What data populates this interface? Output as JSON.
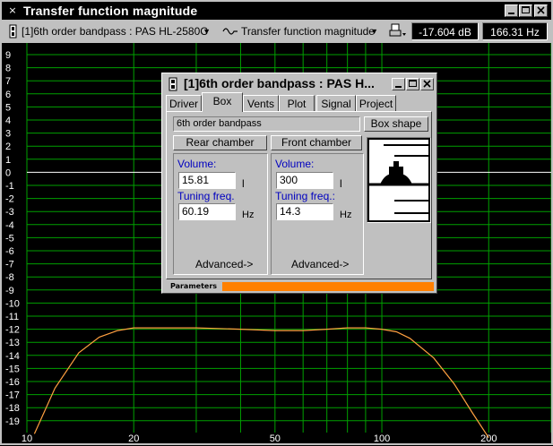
{
  "window": {
    "title": "Transfer function magnitude",
    "system_menu_glyph": "×"
  },
  "toolbar": {
    "project_select": "[1]6th order bandpass : PAS HL-2580C",
    "view_select": "Transfer function magnitude",
    "level_readout": "-17.604 dB",
    "freq_readout": "166.31 Hz"
  },
  "plot": {
    "y_ticks": [
      "9",
      "8",
      "7",
      "6",
      "5",
      "4",
      "3",
      "2",
      "1",
      "0",
      "-1",
      "-2",
      "-3",
      "-4",
      "-5",
      "-6",
      "-7",
      "-8",
      "-9",
      "-10",
      "-11",
      "-12",
      "-13",
      "-14",
      "-15",
      "-16",
      "-17",
      "-18",
      "-19"
    ],
    "x_ticks": [
      "10",
      "20",
      "50",
      "100",
      "200"
    ],
    "grid_color": "#00a000",
    "curve_color": "#ffa040",
    "zero_line_color": "#ffffff"
  },
  "chart_data": {
    "type": "line",
    "x_scale": "log",
    "xlim": [
      10,
      300
    ],
    "ylim": [
      -20,
      10
    ],
    "series": [
      {
        "x": [
          10.5,
          12,
          14,
          16,
          18,
          20,
          25,
          30,
          40,
          50,
          60,
          70,
          80,
          90,
          100,
          110,
          120,
          140,
          160,
          180,
          200
        ],
        "y": [
          -20,
          -16.5,
          -13.8,
          -12.6,
          -12.1,
          -11.9,
          -11.9,
          -11.9,
          -12,
          -12.1,
          -12.1,
          -12,
          -11.9,
          -11.9,
          -12,
          -12.2,
          -12.7,
          -14.2,
          -16.2,
          -18.4,
          -20.3
        ]
      }
    ]
  },
  "dialog": {
    "title": "[1]6th order bandpass : PAS H...",
    "tabs": [
      "Driver",
      "Box",
      "Vents",
      "Plot",
      "Signal",
      "Project"
    ],
    "active_tab": "Box",
    "box_type": "6th order bandpass",
    "box_shape_button": "Box shape",
    "rear_chamber_button": "Rear chamber",
    "front_chamber_button": "Front chamber",
    "rear": {
      "volume_label": "Volume:",
      "volume_value": "15.81",
      "volume_unit": "l",
      "tuning_label": "Tuning freq.",
      "tuning_value": "60.19",
      "tuning_unit": "Hz",
      "advanced": "Advanced->"
    },
    "front": {
      "volume_label": "Volume:",
      "volume_value": "300",
      "volume_unit": "l",
      "tuning_label": "Tuning freq.:",
      "tuning_value": "14.3",
      "tuning_unit": "Hz",
      "advanced": "Advanced->"
    },
    "status_label": "Parameters",
    "status_color": "#ff8000"
  }
}
